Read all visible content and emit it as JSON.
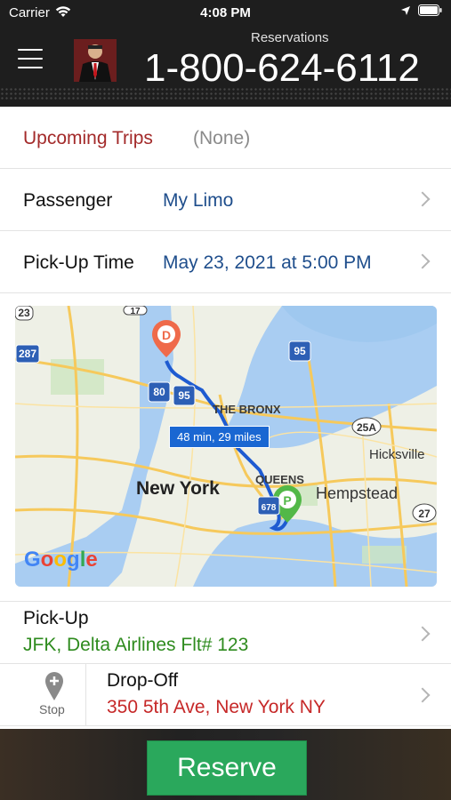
{
  "status_bar": {
    "carrier": "Carrier",
    "time": "4:08 PM"
  },
  "header": {
    "reservations_label": "Reservations",
    "phone": "1-800-624-6112"
  },
  "upcoming": {
    "label": "Upcoming Trips",
    "value": "(None)"
  },
  "passenger": {
    "label": "Passenger",
    "value": "My Limo"
  },
  "pickup_time": {
    "label": "Pick-Up Time",
    "value": "May 23, 2021 at 5:00 PM"
  },
  "map": {
    "route_label": "48 min, 29 miles",
    "places": {
      "new_york": "New York",
      "the_bronx": "THE BRONX",
      "queens": "QUEENS",
      "hempstead": "Hempstead",
      "hicksville": "Hicksville"
    },
    "shields": {
      "i287": "287",
      "i80": "80",
      "i95a": "95",
      "i95b": "95",
      "r25a": "25A",
      "r27": "27",
      "r23": "23",
      "r17": "17",
      "r678": "678"
    },
    "markers": {
      "dropoff": "D",
      "pickup": "P"
    },
    "attribution": "Google"
  },
  "pickup": {
    "label": "Pick-Up",
    "value": "JFK, Delta Airlines Flt# 123"
  },
  "stop": {
    "label": "Stop"
  },
  "dropoff": {
    "label": "Drop-Off",
    "value": "350 5th Ave, New York NY"
  },
  "reserve_button": {
    "label": "Reserve"
  },
  "colors": {
    "accent_red": "#a32a2a",
    "link_blue": "#1f4e8c",
    "pickup_green": "#2e8b1e",
    "dropoff_red": "#c62828",
    "reserve_green": "#2aa85c"
  }
}
